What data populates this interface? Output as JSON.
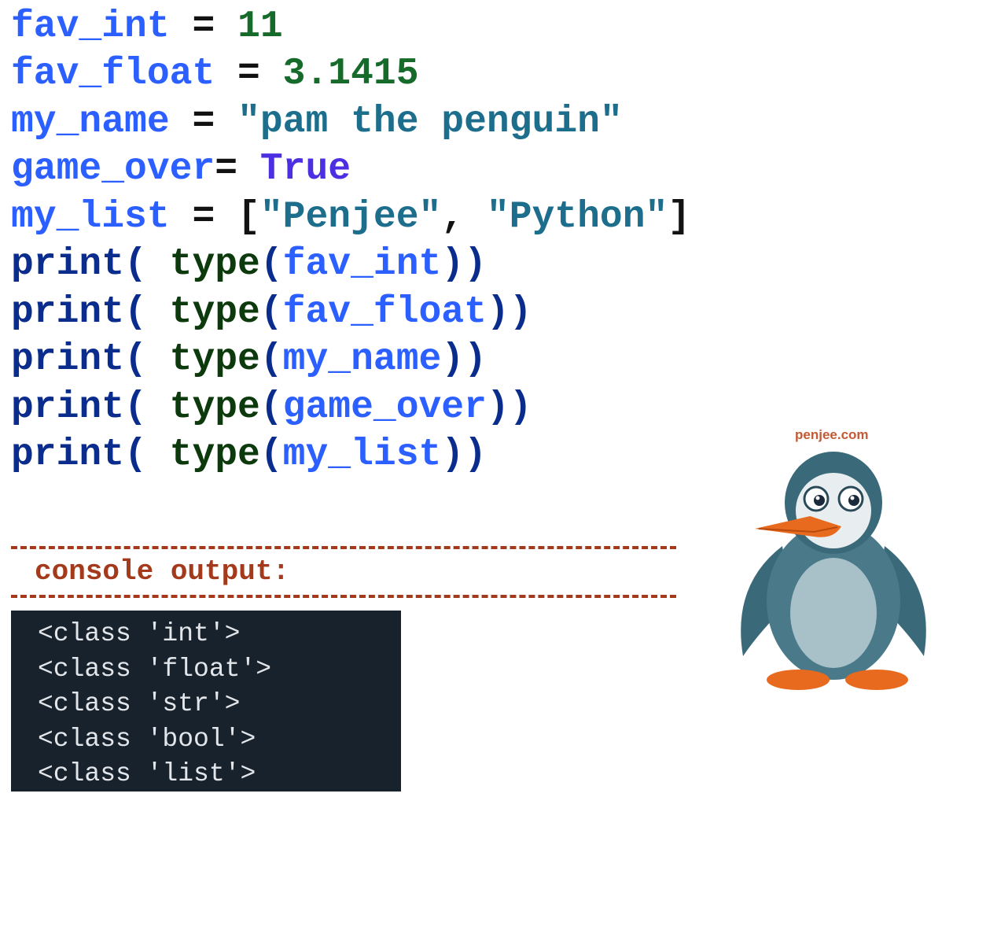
{
  "code": {
    "lines": [
      [
        {
          "cls": "t-blue",
          "text": "fav_int"
        },
        {
          "cls": "t-black",
          "text": " = "
        },
        {
          "cls": "t-num",
          "text": "11"
        }
      ],
      [
        {
          "cls": "t-blue",
          "text": "fav_float"
        },
        {
          "cls": "t-black",
          "text": " = "
        },
        {
          "cls": "t-num",
          "text": "3.1415"
        }
      ],
      [
        {
          "cls": "t-blue",
          "text": "my_name"
        },
        {
          "cls": "t-black",
          "text": " = "
        },
        {
          "cls": "t-str",
          "text": "\"pam the penguin\""
        }
      ],
      [
        {
          "cls": "t-blue",
          "text": "game_over"
        },
        {
          "cls": "t-black",
          "text": "= "
        },
        {
          "cls": "t-kw",
          "text": "True"
        }
      ],
      [
        {
          "cls": "t-blue",
          "text": "my_list"
        },
        {
          "cls": "t-black",
          "text": " = ["
        },
        {
          "cls": "t-str",
          "text": "\"Penjee\""
        },
        {
          "cls": "t-black",
          "text": ", "
        },
        {
          "cls": "t-str",
          "text": "\"Python\""
        },
        {
          "cls": "t-black",
          "text": "]"
        }
      ],
      [
        {
          "cls": "t-call",
          "text": "print( "
        },
        {
          "cls": "t-type",
          "text": "type"
        },
        {
          "cls": "t-call",
          "text": "("
        },
        {
          "cls": "t-blue",
          "text": "fav_int"
        },
        {
          "cls": "t-call",
          "text": "))"
        }
      ],
      [
        {
          "cls": "t-call",
          "text": "print( "
        },
        {
          "cls": "t-type",
          "text": "type"
        },
        {
          "cls": "t-call",
          "text": "("
        },
        {
          "cls": "t-blue",
          "text": "fav_float"
        },
        {
          "cls": "t-call",
          "text": "))"
        }
      ],
      [
        {
          "cls": "t-call",
          "text": "print( "
        },
        {
          "cls": "t-type",
          "text": "type"
        },
        {
          "cls": "t-call",
          "text": "("
        },
        {
          "cls": "t-blue",
          "text": "my_name"
        },
        {
          "cls": "t-call",
          "text": "))"
        }
      ],
      [
        {
          "cls": "t-call",
          "text": "print( "
        },
        {
          "cls": "t-type",
          "text": "type"
        },
        {
          "cls": "t-call",
          "text": "("
        },
        {
          "cls": "t-blue",
          "text": "game_over"
        },
        {
          "cls": "t-call",
          "text": "))"
        }
      ],
      [
        {
          "cls": "t-call",
          "text": "print( "
        },
        {
          "cls": "t-type",
          "text": "type"
        },
        {
          "cls": "t-call",
          "text": "("
        },
        {
          "cls": "t-blue",
          "text": "my_list"
        },
        {
          "cls": "t-call",
          "text": "))"
        }
      ]
    ]
  },
  "console": {
    "label": "console output:",
    "lines": [
      "<class 'int'>",
      "<class 'float'>",
      "<class 'str'>",
      "<class 'bool'>",
      "<class 'list'>"
    ]
  },
  "watermark": "penjee.com"
}
